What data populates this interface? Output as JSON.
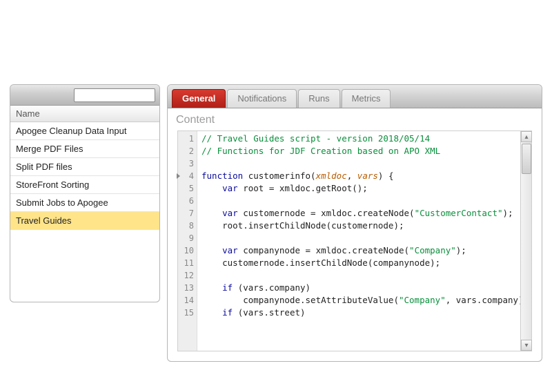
{
  "sidebar": {
    "search": {
      "value": "",
      "placeholder": ""
    },
    "column_header": "Name",
    "items": [
      {
        "label": "Apogee Cleanup Data Input",
        "selected": false
      },
      {
        "label": "Merge PDF Files",
        "selected": false
      },
      {
        "label": "Split PDF files",
        "selected": false
      },
      {
        "label": "StoreFront Sorting",
        "selected": false
      },
      {
        "label": "Submit Jobs to Apogee",
        "selected": false
      },
      {
        "label": "Travel Guides",
        "selected": true
      }
    ]
  },
  "tabs": [
    {
      "label": "General",
      "active": true
    },
    {
      "label": "Notifications",
      "active": false
    },
    {
      "label": "Runs",
      "active": false
    },
    {
      "label": "Metrics",
      "active": false
    }
  ],
  "section_title": "Content",
  "code": {
    "first_line": 1,
    "fold_lines": [
      4
    ],
    "lines": [
      [
        {
          "t": "com",
          "s": "// Travel Guides script - version 2018/05/14"
        }
      ],
      [
        {
          "t": "com",
          "s": "// Functions for JDF Creation based on APO XML"
        }
      ],
      [],
      [
        {
          "t": "kw",
          "s": "function "
        },
        {
          "t": "fn",
          "s": "customerinfo"
        },
        {
          "t": "",
          "s": "("
        },
        {
          "t": "prm",
          "s": "xmldoc"
        },
        {
          "t": "",
          "s": ", "
        },
        {
          "t": "prm",
          "s": "vars"
        },
        {
          "t": "",
          "s": ") {"
        }
      ],
      [
        {
          "t": "",
          "s": "    "
        },
        {
          "t": "kw",
          "s": "var"
        },
        {
          "t": "",
          "s": " root = xmldoc.getRoot();"
        }
      ],
      [],
      [
        {
          "t": "",
          "s": "    "
        },
        {
          "t": "kw",
          "s": "var"
        },
        {
          "t": "",
          "s": " customernode = xmldoc.createNode("
        },
        {
          "t": "str",
          "s": "\"CustomerContact\""
        },
        {
          "t": "",
          "s": ");"
        }
      ],
      [
        {
          "t": "",
          "s": "    root.insertChildNode(customernode);"
        }
      ],
      [],
      [
        {
          "t": "",
          "s": "    "
        },
        {
          "t": "kw",
          "s": "var"
        },
        {
          "t": "",
          "s": " companynode = xmldoc.createNode("
        },
        {
          "t": "str",
          "s": "\"Company\""
        },
        {
          "t": "",
          "s": ");"
        }
      ],
      [
        {
          "t": "",
          "s": "    customernode.insertChildNode(companynode);"
        }
      ],
      [],
      [
        {
          "t": "",
          "s": "    "
        },
        {
          "t": "kw",
          "s": "if"
        },
        {
          "t": "",
          "s": " (vars.company)"
        }
      ],
      [
        {
          "t": "",
          "s": "        companynode.setAttributeValue("
        },
        {
          "t": "str",
          "s": "\"Company\""
        },
        {
          "t": "",
          "s": ", vars.company);"
        }
      ],
      [
        {
          "t": "",
          "s": "    "
        },
        {
          "t": "kw",
          "s": "if"
        },
        {
          "t": "",
          "s": " (vars.street)"
        }
      ]
    ]
  }
}
